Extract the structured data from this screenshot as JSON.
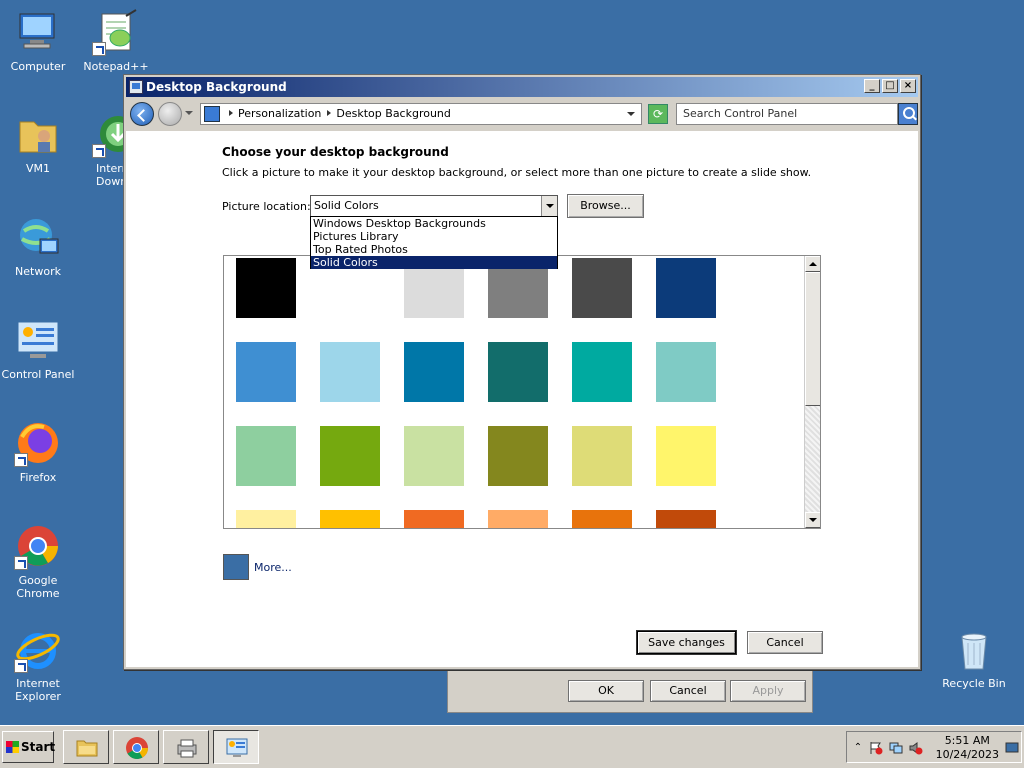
{
  "desktop": {
    "icons": [
      {
        "label": "Computer"
      },
      {
        "label": "Notepad++"
      },
      {
        "label": "VM1"
      },
      {
        "label": "Intern\nDownl"
      },
      {
        "label": "Network"
      },
      {
        "label": "Control Panel"
      },
      {
        "label": "Firefox"
      },
      {
        "label": "Google Chrome"
      },
      {
        "label": "Internet\nExplorer"
      },
      {
        "label": "Recycle Bin"
      }
    ]
  },
  "back_dialog": {
    "ok_label": "OK",
    "cancel_label": "Cancel",
    "apply_label": "Apply"
  },
  "window": {
    "title": "Desktop Background",
    "breadcrumbs": [
      "Personalization",
      "Desktop Background"
    ],
    "search_placeholder": "Search Control Panel",
    "heading": "Choose your desktop background",
    "subtext": "Click a picture to make it your desktop background, or select more than one picture to create a slide show.",
    "picture_location_label": "Picture location:",
    "picture_location_value": "Solid Colors",
    "browse_label": "Browse...",
    "location_options": [
      "Windows Desktop Backgrounds",
      "Pictures Library",
      "Top Rated Photos",
      "Solid Colors"
    ],
    "selected_option": "Solid Colors",
    "swatches": [
      "#000000",
      null,
      "#dcdcdc",
      "#7f7f7f",
      "#4a4a4a",
      "#0c3b7a",
      "#3f8fd2",
      "#9dd6ea",
      "#0077a8",
      "#126d6b",
      "#00aaa0",
      "#7fcbc5",
      "#8ecf9f",
      "#75a90f",
      "#c9e1a2",
      "#84871e",
      "#dedc77",
      "#fff56b",
      "#fff0a0",
      "#ffc000",
      "#f06a22",
      "#ffab66",
      "#e8730c",
      "#c14a0a"
    ],
    "more_label": "More...",
    "more_color": "#3a6ea5",
    "save_label": "Save changes",
    "cancel_label": "Cancel"
  },
  "taskbar": {
    "start_label": "Start",
    "apps": [
      "file-explorer",
      "google-chrome",
      "network-printer",
      "control-panel"
    ],
    "clock_time": "5:51 AM",
    "clock_date": "10/24/2023"
  },
  "colors": {
    "desktop": "#3a6ea5",
    "title_gradient_start": "#0a246a",
    "title_gradient_end": "#a6caf0",
    "selection": "#0a246a"
  }
}
